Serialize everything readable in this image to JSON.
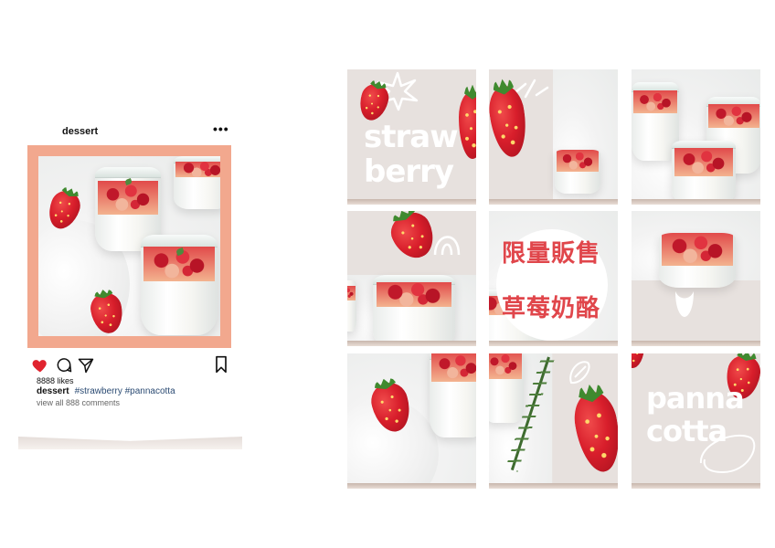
{
  "post": {
    "username": "dessert",
    "more_label": "•••",
    "likes": "8888 likes",
    "caption_user": "dessert",
    "caption_tags": "#strawberry #pannacotta",
    "comments": "view all 888 comments"
  },
  "grid": {
    "word_straw": "straw",
    "word_berry": "berry",
    "cn_line1": "限量販售",
    "cn_line2": "草莓奶酪",
    "word_panna": "panna",
    "word_cotta": "cotta"
  },
  "colors": {
    "frame": "#f2a88e",
    "tile_beige": "#e7e1de",
    "accent_red": "#e0464b",
    "like_red": "#e0232e",
    "tag_blue": "#2b4b73"
  },
  "icons": [
    "heart-icon",
    "comment-icon",
    "share-icon",
    "bookmark-icon",
    "more-icon"
  ]
}
